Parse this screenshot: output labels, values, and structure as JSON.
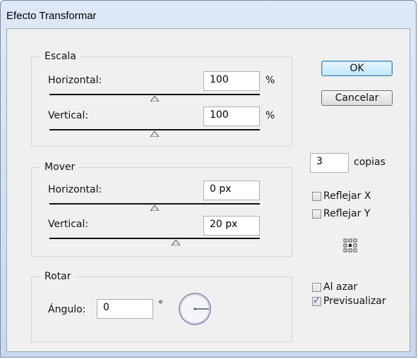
{
  "window": {
    "title": "Efecto Transformar"
  },
  "scale": {
    "legend": "Escala",
    "horizontal": {
      "label": "Horizontal:",
      "value": "100",
      "unit": "%",
      "slider_fraction": 0.5
    },
    "vertical": {
      "label": "Vertical:",
      "value": "100",
      "unit": "%",
      "slider_fraction": 0.5
    }
  },
  "move": {
    "legend": "Mover",
    "horizontal": {
      "label": "Horizontal:",
      "value": "0 px",
      "slider_fraction": 0.5
    },
    "vertical": {
      "label": "Vertical:",
      "value": "20 px",
      "slider_fraction": 0.6
    }
  },
  "rotate": {
    "legend": "Rotar",
    "angle_label": "Ángulo:",
    "angle_value": "0",
    "degree_symbol": "°",
    "dial_angle_degrees": 0
  },
  "buttons": {
    "ok": "OK",
    "cancel": "Cancelar"
  },
  "copies": {
    "value": "3",
    "label": "copias"
  },
  "options": {
    "reflect_x": {
      "label": "Reflejar X",
      "checked": false
    },
    "reflect_y": {
      "label": "Reflejar Y",
      "checked": false
    },
    "random": {
      "label": "Al azar",
      "checked": false
    },
    "preview": {
      "label": "Previsualizar",
      "checked": true
    }
  },
  "reference_point_icon": "reference-point-grid-icon",
  "colors": {
    "dialog_bg": "#f0f0f0",
    "titlebar": "#c8d9ee",
    "check": "#2d52a0",
    "default_button": "#bee6fd"
  }
}
